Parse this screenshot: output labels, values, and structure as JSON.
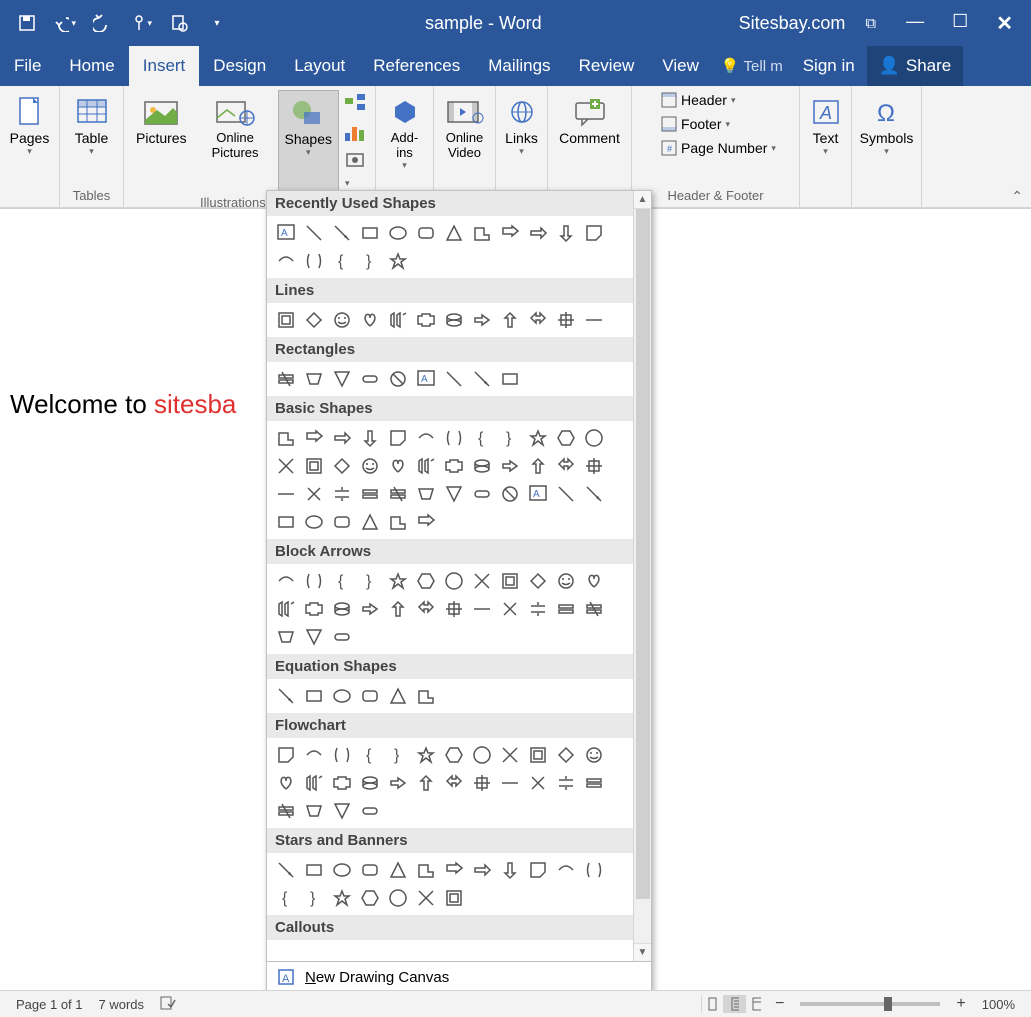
{
  "titlebar": {
    "document_title": "sample - Word",
    "site_url": "Sitesbay.com"
  },
  "menu": {
    "items": [
      "File",
      "Home",
      "Insert",
      "Design",
      "Layout",
      "References",
      "Mailings",
      "Review",
      "View"
    ],
    "active": "Insert",
    "tell_me": "Tell m",
    "sign_in": "Sign in",
    "share": "Share"
  },
  "ribbon": {
    "groups": {
      "pages_label": "",
      "tables_label": "Tables",
      "illustrations_label": "Illustrations",
      "header_footer_label": "Header & Footer"
    },
    "pages": "Pages",
    "table": "Table",
    "pictures": "Pictures",
    "online_pictures": "Online Pictures",
    "shapes": "Shapes",
    "addins": "Add-ins",
    "online_video": "Online Video",
    "links": "Links",
    "comment": "Comment",
    "header": "Header",
    "footer": "Footer",
    "page_number": "Page Number",
    "text": "Text",
    "symbols": "Symbols"
  },
  "document": {
    "text_prefix": "Welcome to ",
    "text_colored": "sitesba"
  },
  "shapes_dropdown": {
    "sections": [
      "Recently Used Shapes",
      "Lines",
      "Rectangles",
      "Basic Shapes",
      "Block Arrows",
      "Equation Shapes",
      "Flowchart",
      "Stars and Banners",
      "Callouts"
    ],
    "section_counts": {
      "Recently Used Shapes": 17,
      "Lines": 12,
      "Rectangles": 9,
      "Basic Shapes": 42,
      "Block Arrows": 27,
      "Equation Shapes": 6,
      "Flowchart": 28,
      "Stars and Banners": 19
    },
    "footer": "New Drawing Canvas"
  },
  "statusbar": {
    "page_info": "Page 1 of 1",
    "word_count": "7 words",
    "zoom_percent": "100%"
  }
}
